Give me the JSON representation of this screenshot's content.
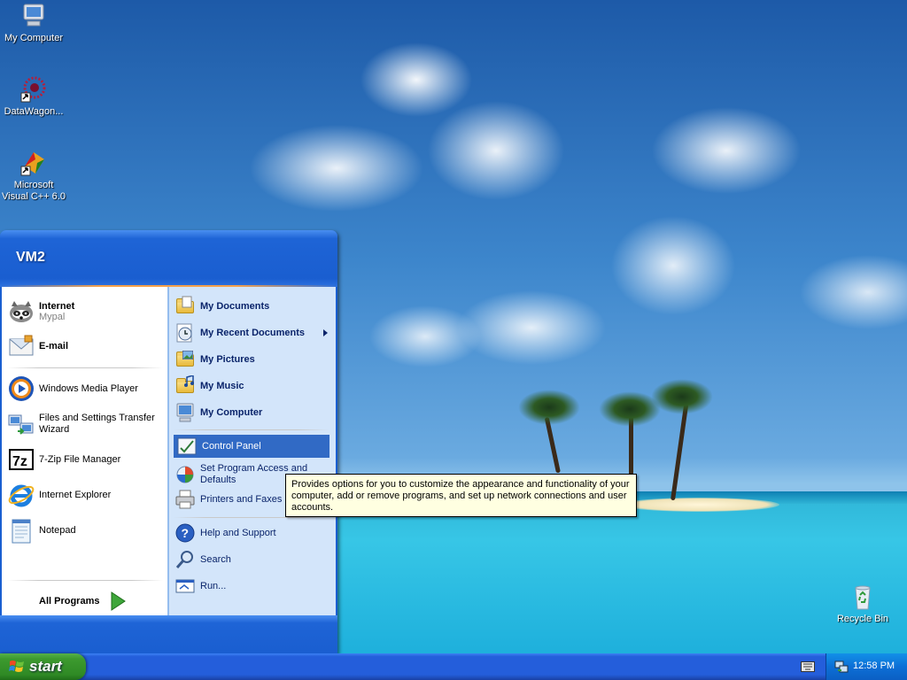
{
  "desktop": {
    "icons": [
      {
        "label": "My Computer",
        "icon": "my-computer-icon"
      },
      {
        "label": "DataWagon...",
        "icon": "datawagon-icon"
      },
      {
        "label": "Microsoft Visual C++ 6.0",
        "icon": "visual-cpp-icon"
      },
      {
        "label": "Recycle Bin",
        "icon": "recycle-bin-icon"
      }
    ]
  },
  "start_menu": {
    "user_name": "VM2",
    "pinned": [
      {
        "label": "Internet",
        "sub": "Mypal",
        "icon": "raccoon-browser-icon"
      },
      {
        "label": "E-mail",
        "icon": "email-icon"
      }
    ],
    "recent": [
      {
        "label": "Windows Media Player",
        "icon": "media-player-icon"
      },
      {
        "label": "Files and Settings Transfer Wizard",
        "icon": "transfer-wizard-icon"
      },
      {
        "label": "7-Zip File Manager",
        "icon": "7zip-icon"
      },
      {
        "label": "Internet Explorer",
        "icon": "internet-explorer-icon"
      },
      {
        "label": "Notepad",
        "icon": "notepad-icon"
      }
    ],
    "all_programs": "All Programs",
    "places": [
      {
        "label": "My Documents",
        "icon": "my-documents-icon"
      },
      {
        "label": "My Recent Documents",
        "icon": "recent-documents-icon"
      },
      {
        "label": "My Pictures",
        "icon": "my-pictures-icon"
      },
      {
        "label": "My Music",
        "icon": "my-music-icon"
      },
      {
        "label": "My Computer",
        "icon": "my-computer-icon"
      }
    ],
    "settings": [
      {
        "label": "Control Panel",
        "icon": "control-panel-icon"
      },
      {
        "label": "Set Program Access and Defaults",
        "icon": "program-access-icon"
      },
      {
        "label": "Printers and Faxes",
        "icon": "printer-icon"
      }
    ],
    "help": [
      {
        "label": "Help and Support",
        "icon": "help-icon"
      },
      {
        "label": "Search",
        "icon": "search-icon"
      },
      {
        "label": "Run...",
        "icon": "run-icon"
      }
    ],
    "tooltip": "Provides options for you to customize the appearance and functionality of your computer, add or remove programs, and set up network connections and user accounts.",
    "highlight_color": "#316ac5"
  },
  "taskbar": {
    "start_label": "start",
    "clock": "12:58 PM",
    "accent": "#245edb",
    "start_color": "#3d9a2f"
  }
}
